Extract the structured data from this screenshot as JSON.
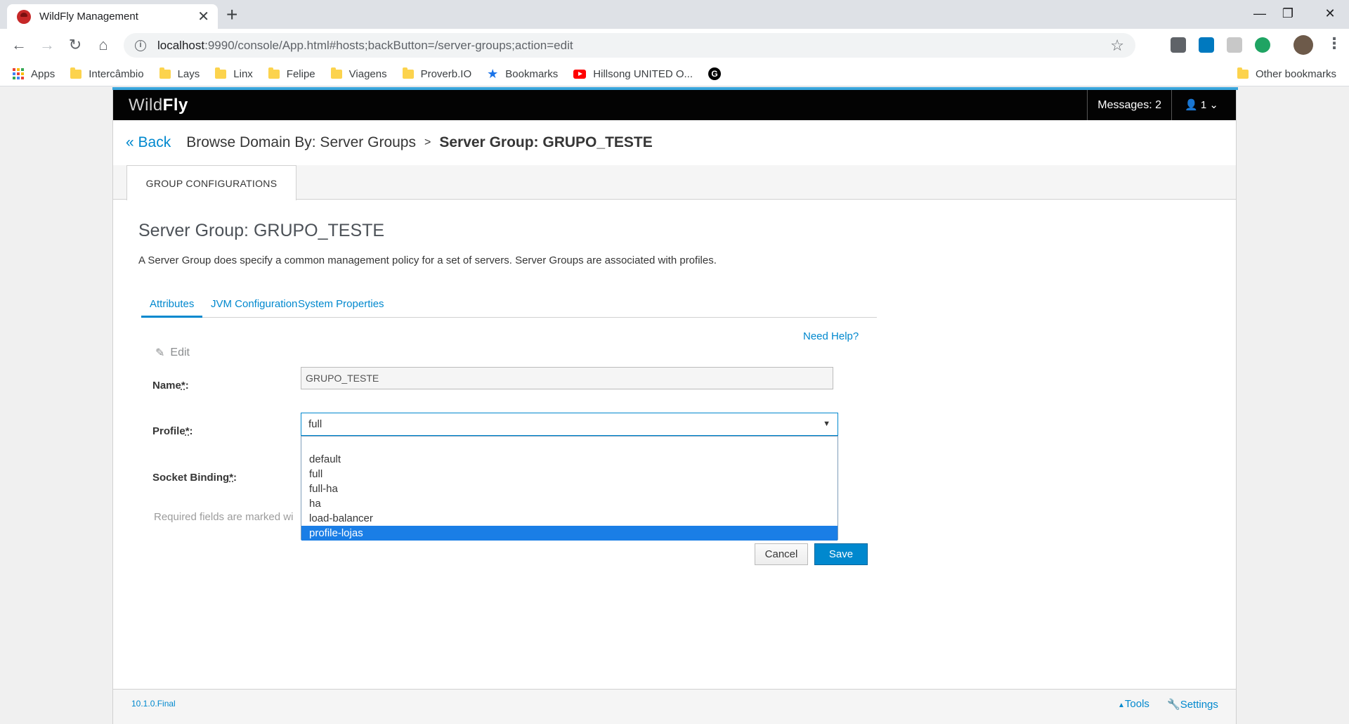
{
  "browser": {
    "tab_title": "WildFly Management",
    "tab_close": "✕",
    "new_tab": "+",
    "url_host": "localhost",
    "url_rest": ":9990/console/App.html#hosts;backButton=/server-groups;action=edit",
    "window_min": "—",
    "window_restore": "❐",
    "window_close": "✕",
    "bookmarks": [
      "Apps",
      "Intercâmbio",
      "Lays",
      "Linx",
      "Felipe",
      "Viagens",
      "Proverb.IO",
      "Bookmarks",
      "Hillsong UNITED O..."
    ],
    "other_bookmarks": "Other bookmarks",
    "g_letter": "G"
  },
  "header": {
    "logo_light": "Wild",
    "logo_bold": "Fly",
    "messages": "Messages: 2",
    "user": "1"
  },
  "breadcrumb": {
    "back": "Back",
    "parent": "Browse Domain By: Server Groups",
    "separator": ">",
    "current": "Server Group: GRUPO_TESTE"
  },
  "config_tab": "GROUP CONFIGURATIONS",
  "main": {
    "title": "Server Group: GRUPO_TESTE",
    "description": "A Server Group does specify a common management policy for a set of servers. Server Groups are associated with profiles.",
    "subtabs": [
      "Attributes",
      "JVM Configuration",
      "System Properties"
    ],
    "need_help": "Need Help?",
    "edit": "Edit"
  },
  "form": {
    "name_label": "Name",
    "profile_label": "Profile",
    "socket_label": "Socket Binding",
    "required_marker": "*",
    "colon": ":",
    "name_value": "GRUPO_TESTE",
    "profile_value": "full",
    "profile_options": [
      "default",
      "full",
      "full-ha",
      "ha",
      "load-balancer",
      "profile-lojas"
    ],
    "highlighted_option": "profile-lojas",
    "required_note": "Required fields are marked wi",
    "cancel": "Cancel",
    "save": "Save"
  },
  "footer": {
    "version": "10.1.0.Final",
    "tools": "Tools",
    "settings": "Settings"
  },
  "colors": {
    "accent": "#0088ce",
    "header_bg": "#030303",
    "selected_option": "#1a7ee6"
  }
}
